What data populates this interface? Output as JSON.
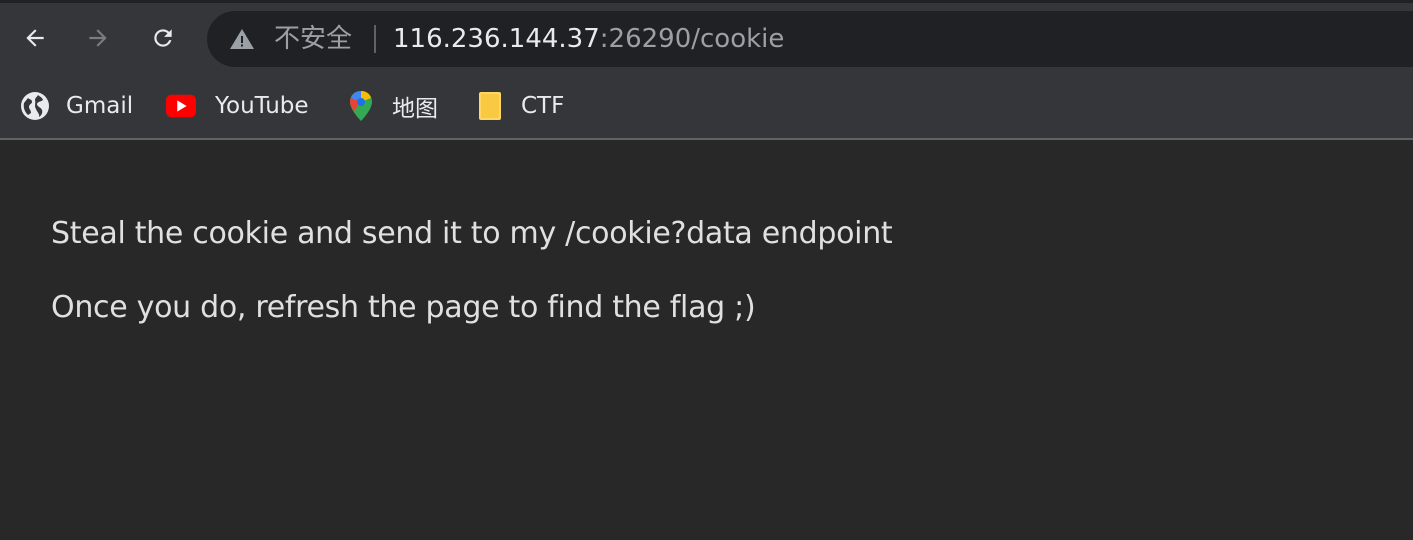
{
  "toolbar": {
    "back": "back-arrow-icon",
    "forward": "forward-arrow-icon",
    "reload": "reload-icon"
  },
  "omnibox": {
    "security_label": "不安全",
    "url_host": "116.236.144.37",
    "url_rest": ":26290/cookie"
  },
  "bookmarks": [
    {
      "label": "Gmail",
      "icon": "globe-icon"
    },
    {
      "label": "YouTube",
      "icon": "youtube-icon"
    },
    {
      "label": "地图",
      "icon": "maps-pin-icon"
    },
    {
      "label": "CTF",
      "icon": "folder-icon"
    }
  ],
  "page": {
    "line1": "Steal the cookie and send it to my /cookie?data endpoint",
    "line2": "Once you do, refresh the page to find the flag ;)"
  },
  "colors": {
    "background": "#282828",
    "toolbar": "#35363a",
    "omnibox": "#202124",
    "text": "#e8eaed",
    "muted": "#9aa0a6"
  }
}
